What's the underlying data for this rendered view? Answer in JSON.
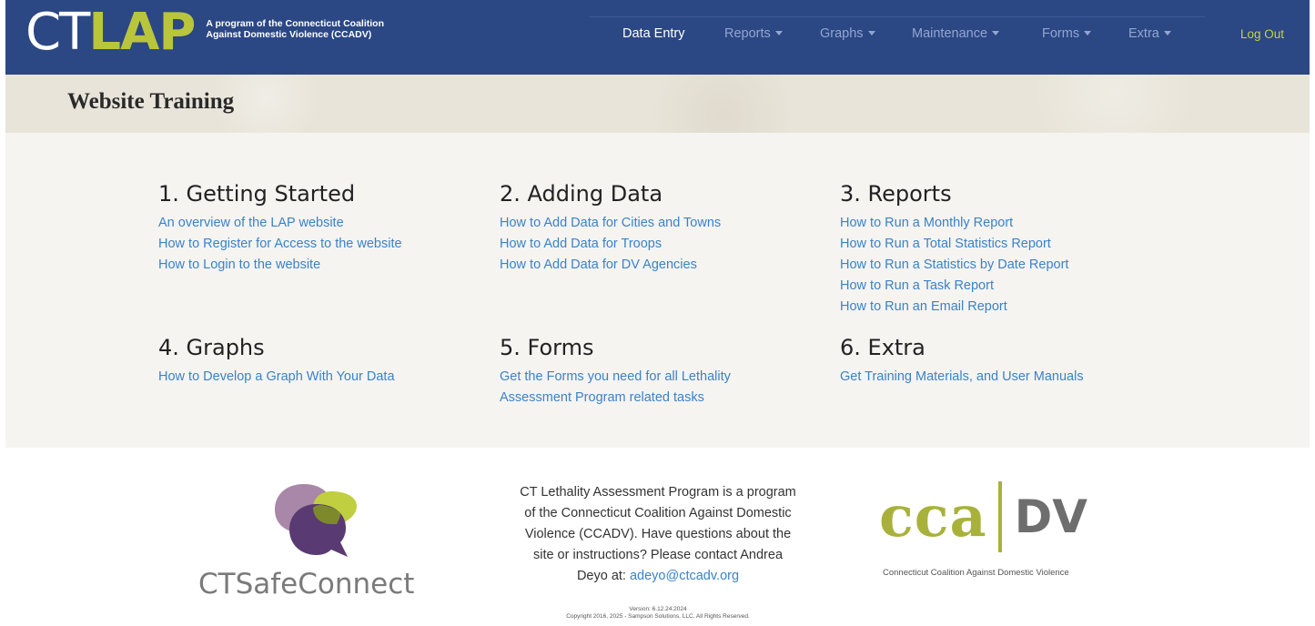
{
  "brand": {
    "logo_ct": "CT",
    "logo_lap": "LAP",
    "tagline_line1": "A program of the Connecticut Coalition",
    "tagline_line2": "Against Domestic Violence (CCADV)"
  },
  "nav": {
    "items": [
      {
        "label": "Data Entry",
        "active": true,
        "dropdown": false
      },
      {
        "label": "Reports",
        "active": false,
        "dropdown": true
      },
      {
        "label": "Graphs",
        "active": false,
        "dropdown": true
      },
      {
        "label": "Maintenance",
        "active": false,
        "dropdown": true
      },
      {
        "label": "Forms",
        "active": false,
        "dropdown": true
      },
      {
        "label": "Extra",
        "active": false,
        "dropdown": true
      }
    ],
    "logout": "Log Out"
  },
  "page": {
    "title": "Website Training"
  },
  "sections": [
    {
      "heading": "1. Getting Started",
      "links": [
        "An overview of the LAP website",
        "How to Register for Access to the website",
        "How to Login to the website"
      ]
    },
    {
      "heading": "2. Adding Data",
      "links": [
        "How to Add Data for Cities and Towns",
        "How to Add Data for Troops",
        "How to Add Data for DV Agencies"
      ]
    },
    {
      "heading": "3. Reports",
      "links": [
        "How to Run a Monthly Report",
        "How to Run a Total Statistics Report",
        "How to Run a Statistics by Date Report",
        "How to Run a Task Report",
        "How to Run an Email Report"
      ]
    },
    {
      "heading": "4. Graphs",
      "links": [
        "How to Develop a Graph With Your Data"
      ]
    },
    {
      "heading": "5. Forms",
      "links": [
        "Get the Forms you need for all Lethality",
        "Assessment Program related tasks"
      ]
    },
    {
      "heading": "6. Extra",
      "links": [
        "Get Training Materials, and User Manuals"
      ]
    }
  ],
  "footer": {
    "safeconnect": "CTSafeConnect",
    "lines": [
      "CT Lethality Assessment Program is a program",
      "of the Connecticut Coalition Against Domestic",
      "Violence (CCADV). Have questions about the",
      "site or instructions? Please contact Andrea"
    ],
    "contact_prefix": "Deyo at: ",
    "email": "adeyo@ctcadv.org",
    "version": "Version: 6.12.24.2024",
    "copyright": "Copyright 2016, 2025 - Sampson Solutions, LLC. All Rights Reserved.",
    "cca_word": "cca",
    "dv_word": "DV",
    "cca_sub": "Connecticut Coalition Against Domestic Violence"
  },
  "colors": {
    "navbar": "#2b4784",
    "accent_green": "#b9c53a",
    "link": "#3b82c8"
  }
}
